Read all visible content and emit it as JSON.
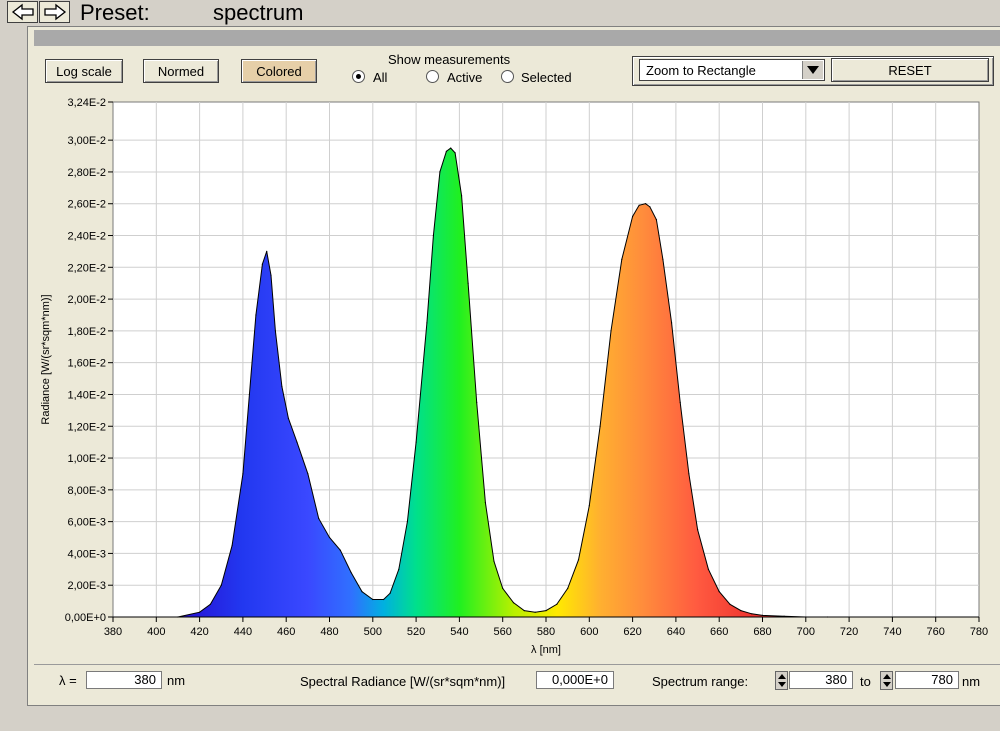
{
  "header": {
    "preset_label": "Preset:",
    "preset_value": "spectrum"
  },
  "toolbar": {
    "log_scale": "Log scale",
    "normed": "Normed",
    "colored": "Colored",
    "show_measurements": "Show measurements",
    "radio": [
      {
        "label": "All",
        "checked": true
      },
      {
        "label": "Active",
        "checked": false
      },
      {
        "label": "Selected",
        "checked": false
      }
    ],
    "zoom_mode": "Zoom to Rectangle",
    "reset": "RESET"
  },
  "footer": {
    "lambda_label": "λ =",
    "lambda_value": "380",
    "lambda_unit": "nm",
    "radiance_label": "Spectral Radiance [W/(sr*sqm*nm)]",
    "radiance_value": "0,000E+0",
    "range_label": "Spectrum range:",
    "range_from": "380",
    "range_to_label": "to",
    "range_to": "780",
    "range_unit": "nm"
  },
  "chart_data": {
    "type": "area",
    "xlabel": "λ [nm]",
    "ylabel": "Radiance [W/(sr*sqm*nm)]",
    "xlim": [
      380,
      780
    ],
    "ylim": [
      0,
      0.0324
    ],
    "grid": true,
    "x_ticks": [
      380,
      400,
      420,
      440,
      460,
      480,
      500,
      520,
      540,
      560,
      580,
      600,
      620,
      640,
      660,
      680,
      700,
      720,
      740,
      760,
      780
    ],
    "y_ticks": [
      {
        "v": 0.0,
        "label": "0,00E+0"
      },
      {
        "v": 0.002,
        "label": "2,00E-3"
      },
      {
        "v": 0.004,
        "label": "4,00E-3"
      },
      {
        "v": 0.006,
        "label": "6,00E-3"
      },
      {
        "v": 0.008,
        "label": "8,00E-3"
      },
      {
        "v": 0.01,
        "label": "1,00E-2"
      },
      {
        "v": 0.012,
        "label": "1,20E-2"
      },
      {
        "v": 0.014,
        "label": "1,40E-2"
      },
      {
        "v": 0.016,
        "label": "1,60E-2"
      },
      {
        "v": 0.018,
        "label": "1,80E-2"
      },
      {
        "v": 0.02,
        "label": "2,00E-2"
      },
      {
        "v": 0.022,
        "label": "2,20E-2"
      },
      {
        "v": 0.024,
        "label": "2,40E-2"
      },
      {
        "v": 0.026,
        "label": "2,60E-2"
      },
      {
        "v": 0.028,
        "label": "2,80E-2"
      },
      {
        "v": 0.03,
        "label": "3,00E-2"
      },
      {
        "v": 0.0324,
        "label": "3,24E-2"
      }
    ],
    "series": [
      {
        "x": [
          410,
          420,
          425,
          430,
          435,
          440,
          443,
          446,
          449,
          451,
          453,
          455,
          458,
          461,
          465,
          470,
          475,
          480,
          485,
          490,
          495,
          500,
          505,
          508,
          512,
          516,
          520,
          525,
          528,
          531,
          534,
          536,
          538,
          541,
          544,
          548,
          552,
          556,
          560,
          565,
          570,
          575,
          580,
          585,
          590,
          595,
          600,
          605,
          610,
          615,
          620,
          623,
          626,
          628,
          631,
          634,
          638,
          642,
          646,
          650,
          655,
          660,
          665,
          670,
          675,
          680,
          690,
          700,
          710
        ],
        "y": [
          0,
          0.0003,
          0.0008,
          0.002,
          0.0045,
          0.009,
          0.014,
          0.019,
          0.0222,
          0.023,
          0.0215,
          0.018,
          0.0145,
          0.0125,
          0.011,
          0.009,
          0.0062,
          0.005,
          0.0042,
          0.0028,
          0.0016,
          0.0011,
          0.0011,
          0.0015,
          0.003,
          0.006,
          0.011,
          0.0185,
          0.024,
          0.028,
          0.0293,
          0.0295,
          0.0292,
          0.0265,
          0.021,
          0.0135,
          0.0072,
          0.0035,
          0.0018,
          0.0009,
          0.0004,
          0.0003,
          0.0004,
          0.0008,
          0.0018,
          0.0036,
          0.007,
          0.012,
          0.018,
          0.0225,
          0.0252,
          0.0259,
          0.026,
          0.0258,
          0.025,
          0.0225,
          0.0185,
          0.0135,
          0.009,
          0.0055,
          0.003,
          0.0016,
          0.0008,
          0.0004,
          0.0002,
          0.0001,
          5e-05,
          0,
          0
        ]
      }
    ]
  }
}
